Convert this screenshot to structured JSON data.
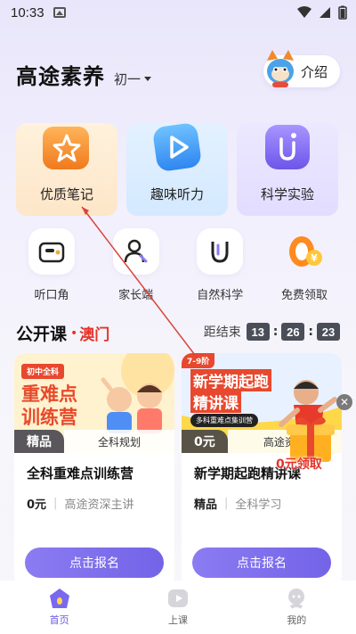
{
  "status": {
    "time": "10:33"
  },
  "header": {
    "title": "高途素养",
    "grade": "初一",
    "intro_label": "介绍"
  },
  "big_cards": [
    {
      "label": "优质笔记"
    },
    {
      "label": "趣味听力"
    },
    {
      "label": "科学实验"
    }
  ],
  "small_items": [
    {
      "label": "听口角"
    },
    {
      "label": "家长端"
    },
    {
      "label": "自然科学"
    },
    {
      "label": "免费领取"
    }
  ],
  "open_course": {
    "title": "公开课",
    "region": "澳门",
    "countdown_label": "距结束",
    "hours": "13",
    "minutes": "26",
    "seconds": "23"
  },
  "courses": [
    {
      "poster_badge": "初中全科",
      "poster_line1": "重难点",
      "poster_line2": "训练营",
      "tag": "精品",
      "sub": "全科规划",
      "name": "全科重难点训练营",
      "price": "0元",
      "teacher": "高途资深主讲",
      "button": "点击报名"
    },
    {
      "poster_badge": "7-9阶",
      "poster_line1": "新学期起跑",
      "poster_line2": "精讲课",
      "poster_ribbon": "多科重难点集训营",
      "tag": "0元",
      "sub": "高途资深",
      "name": "新学期起跑精讲课",
      "price": "精品",
      "teacher": "全科学习",
      "button": "点击报名"
    }
  ],
  "promo": {
    "label": "0元领取"
  },
  "tabs": [
    {
      "label": "首页",
      "active": true
    },
    {
      "label": "上课",
      "active": false
    },
    {
      "label": "我的",
      "active": false
    }
  ],
  "colors": {
    "accent": "#7363e8",
    "highlight": "#e5342a"
  }
}
